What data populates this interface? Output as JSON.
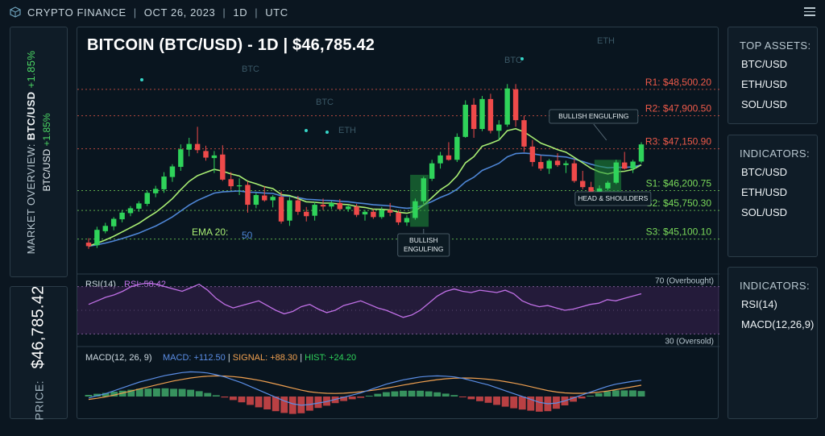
{
  "header": {
    "app_name": "CRYPTO FINANCE",
    "date": "OCT 26, 2023",
    "timeframe": "1D",
    "timezone": "UTC"
  },
  "overview": {
    "label": "MARKET OVERVIEW:",
    "pair": "BTC/USD",
    "change": "+1.85%",
    "pair2": "BTC/USD",
    "change2": "+1.85%"
  },
  "price_panel": {
    "label": "PRICE:",
    "value": "$46,785.42"
  },
  "top_assets": {
    "title": "TOP ASSETS:",
    "items": [
      "BTC/USD",
      "ETH/USD",
      "SOL/USD"
    ]
  },
  "indicators_a": {
    "title": "INDICATORS:",
    "items": [
      "BTC/USD",
      "ETH/USD",
      "SOL/USD"
    ]
  },
  "indicators_b": {
    "title": "INDICATORS:",
    "items": [
      "RSI(14)",
      "MACD(12,26,9)"
    ]
  },
  "colors": {
    "bull": "#2fd35a",
    "bear": "#ef4a4a",
    "ema_fast": "#a8ee73",
    "ema_slow": "#4e86d6",
    "rsi": "#c070e6",
    "macd": "#5b8ee6",
    "signal": "#f0a050",
    "resistance": "#ef5a4a",
    "support": "#7ad95a"
  },
  "chart_data": {
    "type": "candlestick",
    "title": "BITCOIN (BTC/USD) - 1D | $46,785.42",
    "candles": [
      {
        "o": 45020,
        "h": 45120,
        "l": 44880,
        "c": 44940
      },
      {
        "o": 44960,
        "h": 45380,
        "l": 44900,
        "c": 45310
      },
      {
        "o": 45280,
        "h": 45470,
        "l": 45230,
        "c": 45400
      },
      {
        "o": 45390,
        "h": 45600,
        "l": 45300,
        "c": 45560
      },
      {
        "o": 45550,
        "h": 45760,
        "l": 45480,
        "c": 45700
      },
      {
        "o": 45690,
        "h": 45850,
        "l": 45620,
        "c": 45800
      },
      {
        "o": 45790,
        "h": 45960,
        "l": 45720,
        "c": 45910
      },
      {
        "o": 45900,
        "h": 46200,
        "l": 45850,
        "c": 46150
      },
      {
        "o": 46140,
        "h": 46310,
        "l": 46050,
        "c": 46240
      },
      {
        "o": 46230,
        "h": 46620,
        "l": 46150,
        "c": 46520
      },
      {
        "o": 46510,
        "h": 46800,
        "l": 46400,
        "c": 46750
      },
      {
        "o": 46740,
        "h": 47250,
        "l": 46650,
        "c": 47140
      },
      {
        "o": 47130,
        "h": 47400,
        "l": 46980,
        "c": 47260
      },
      {
        "o": 47260,
        "h": 47650,
        "l": 47050,
        "c": 47120
      },
      {
        "o": 47100,
        "h": 47220,
        "l": 46880,
        "c": 46950
      },
      {
        "o": 46940,
        "h": 47100,
        "l": 46600,
        "c": 47000
      },
      {
        "o": 47020,
        "h": 47230,
        "l": 46420,
        "c": 46450
      },
      {
        "o": 46460,
        "h": 46620,
        "l": 46220,
        "c": 46300
      },
      {
        "o": 46300,
        "h": 46480,
        "l": 46100,
        "c": 46320
      },
      {
        "o": 46330,
        "h": 46410,
        "l": 45700,
        "c": 45880
      },
      {
        "o": 45880,
        "h": 46150,
        "l": 45800,
        "c": 46100
      },
      {
        "o": 46090,
        "h": 46300,
        "l": 45950,
        "c": 45980
      },
      {
        "o": 45980,
        "h": 46100,
        "l": 45820,
        "c": 46060
      },
      {
        "o": 46060,
        "h": 46180,
        "l": 45450,
        "c": 45500
      },
      {
        "o": 45520,
        "h": 46050,
        "l": 45400,
        "c": 45980
      },
      {
        "o": 45980,
        "h": 46080,
        "l": 45650,
        "c": 45720
      },
      {
        "o": 45720,
        "h": 45830,
        "l": 45500,
        "c": 45620
      },
      {
        "o": 45630,
        "h": 45950,
        "l": 45520,
        "c": 45880
      },
      {
        "o": 45880,
        "h": 46020,
        "l": 45760,
        "c": 45840
      },
      {
        "o": 45840,
        "h": 45960,
        "l": 45780,
        "c": 45920
      },
      {
        "o": 45920,
        "h": 46010,
        "l": 45760,
        "c": 45780
      },
      {
        "o": 45780,
        "h": 45880,
        "l": 45720,
        "c": 45840
      },
      {
        "o": 45840,
        "h": 45900,
        "l": 45600,
        "c": 45650
      },
      {
        "o": 45660,
        "h": 45760,
        "l": 45520,
        "c": 45720
      },
      {
        "o": 45720,
        "h": 45780,
        "l": 45560,
        "c": 45600
      },
      {
        "o": 45600,
        "h": 45830,
        "l": 45560,
        "c": 45760
      },
      {
        "o": 45760,
        "h": 45920,
        "l": 45620,
        "c": 45700
      },
      {
        "o": 45700,
        "h": 45760,
        "l": 45420,
        "c": 45480
      },
      {
        "o": 45480,
        "h": 45640,
        "l": 45400,
        "c": 45580
      },
      {
        "o": 45580,
        "h": 46020,
        "l": 45540,
        "c": 45960
      },
      {
        "o": 45960,
        "h": 46520,
        "l": 45900,
        "c": 46480
      },
      {
        "o": 46470,
        "h": 46900,
        "l": 46420,
        "c": 46820
      },
      {
        "o": 46820,
        "h": 47080,
        "l": 46700,
        "c": 47000
      },
      {
        "o": 47000,
        "h": 47300,
        "l": 46880,
        "c": 46900
      },
      {
        "o": 46900,
        "h": 47500,
        "l": 46850,
        "c": 47420
      },
      {
        "o": 47420,
        "h": 48250,
        "l": 47400,
        "c": 48150
      },
      {
        "o": 48150,
        "h": 48300,
        "l": 47400,
        "c": 47600
      },
      {
        "o": 47600,
        "h": 48350,
        "l": 47550,
        "c": 48280
      },
      {
        "o": 48280,
        "h": 48400,
        "l": 47500,
        "c": 47560
      },
      {
        "o": 47560,
        "h": 47800,
        "l": 47350,
        "c": 47700
      },
      {
        "o": 47700,
        "h": 48620,
        "l": 47650,
        "c": 48520
      },
      {
        "o": 48500,
        "h": 48620,
        "l": 47650,
        "c": 47800
      },
      {
        "o": 47800,
        "h": 47900,
        "l": 47080,
        "c": 47200
      },
      {
        "o": 47200,
        "h": 47350,
        "l": 46750,
        "c": 46850
      },
      {
        "o": 46850,
        "h": 47000,
        "l": 46650,
        "c": 46700
      },
      {
        "o": 46700,
        "h": 46920,
        "l": 46580,
        "c": 46880
      },
      {
        "o": 46880,
        "h": 47050,
        "l": 46740,
        "c": 46780
      },
      {
        "o": 46780,
        "h": 46880,
        "l": 46600,
        "c": 46820
      },
      {
        "o": 46820,
        "h": 46920,
        "l": 46380,
        "c": 46420
      },
      {
        "o": 46420,
        "h": 46650,
        "l": 46230,
        "c": 46280
      },
      {
        "o": 46280,
        "h": 46400,
        "l": 46100,
        "c": 46150
      },
      {
        "o": 46150,
        "h": 46320,
        "l": 46080,
        "c": 46250
      },
      {
        "o": 46250,
        "h": 46420,
        "l": 46200,
        "c": 46380
      },
      {
        "o": 46380,
        "h": 46900,
        "l": 46350,
        "c": 46840
      },
      {
        "o": 46840,
        "h": 47080,
        "l": 46680,
        "c": 46700
      },
      {
        "o": 46700,
        "h": 46900,
        "l": 46600,
        "c": 46860
      },
      {
        "o": 46860,
        "h": 47300,
        "l": 46820,
        "c": 47250
      }
    ],
    "ema_labels": [
      "EMA 20:",
      "50"
    ],
    "levels": [
      {
        "label": "R1: $48,500.20",
        "value": 48500.2,
        "kind": "resistance"
      },
      {
        "label": "R2: $47,900.50",
        "value": 47900.5,
        "kind": "resistance"
      },
      {
        "label": "R3: $47,150.90",
        "value": 47150.9,
        "kind": "resistance"
      },
      {
        "label": "S1: $46,200.75",
        "value": 46200.75,
        "kind": "support"
      },
      {
        "label": "S2: $45,750.30",
        "value": 45750.3,
        "kind": "support"
      },
      {
        "label": "S3: $45,100.10",
        "value": 45100.1,
        "kind": "support"
      }
    ],
    "annotations": [
      {
        "text": [
          "BULLISH",
          "ENGULFING"
        ],
        "candle": 40
      },
      {
        "text": [
          "BULLISH ENGULFING"
        ],
        "candle": 63
      },
      {
        "text": [
          "HEAD & SHOULDERS"
        ],
        "candle": 58
      }
    ],
    "watermarks": [
      "BTC",
      "BTC",
      "BTC",
      "ETH",
      "ETH"
    ],
    "rsi": {
      "label": "RSI(14)",
      "value_label": "RSI: 58.42",
      "upper_label": "70 (Overbought)",
      "lower_label": "30 (Oversold)",
      "ylim": [
        20,
        80
      ],
      "values": [
        55,
        58,
        61,
        63,
        66,
        70,
        72,
        73,
        72,
        70,
        68,
        66,
        69,
        72,
        67,
        60,
        55,
        52,
        54,
        56,
        58,
        54,
        50,
        47,
        49,
        53,
        55,
        51,
        48,
        50,
        54,
        56,
        58,
        55,
        52,
        50,
        47,
        44,
        46,
        50,
        56,
        62,
        66,
        68,
        66,
        65,
        67,
        66,
        65,
        67,
        64,
        58,
        55,
        53,
        54,
        52,
        50,
        51,
        53,
        55,
        56,
        59,
        58,
        60,
        62,
        64
      ]
    },
    "macd": {
      "label": "MACD(12, 26, 9)",
      "macd_label": "MACD: +112.50",
      "signal_label": "SIGNAL: +88.30",
      "hist_label": "HIST: +24.20",
      "macd_values": [
        -10,
        5,
        20,
        40,
        60,
        80,
        100,
        115,
        130,
        145,
        155,
        165,
        170,
        168,
        162,
        150,
        135,
        115,
        95,
        70,
        45,
        20,
        -5,
        -30,
        -50,
        -60,
        -55,
        -45,
        -35,
        -20,
        -5,
        10,
        25,
        45,
        65,
        85,
        100,
        115,
        125,
        135,
        140,
        142,
        140,
        135,
        125,
        110,
        95,
        80,
        60,
        40,
        20,
        0,
        -20,
        -40,
        -50,
        -45,
        -30,
        -10,
        10,
        30,
        50,
        70,
        85,
        95,
        105,
        112
      ],
      "signal_values": [
        -20,
        -12,
        -2,
        10,
        24,
        38,
        52,
        66,
        80,
        94,
        107,
        118,
        128,
        135,
        140,
        142,
        141,
        137,
        131,
        122,
        112,
        100,
        86,
        72,
        58,
        44,
        33,
        26,
        22,
        21,
        23,
        27,
        33,
        40,
        48,
        58,
        68,
        79,
        89,
        99,
        108,
        116,
        122,
        126,
        128,
        127,
        124,
        119,
        112,
        103,
        93,
        81,
        68,
        54,
        41,
        31,
        25,
        22,
        22,
        25,
        30,
        38,
        47,
        57,
        67,
        78
      ]
    }
  }
}
